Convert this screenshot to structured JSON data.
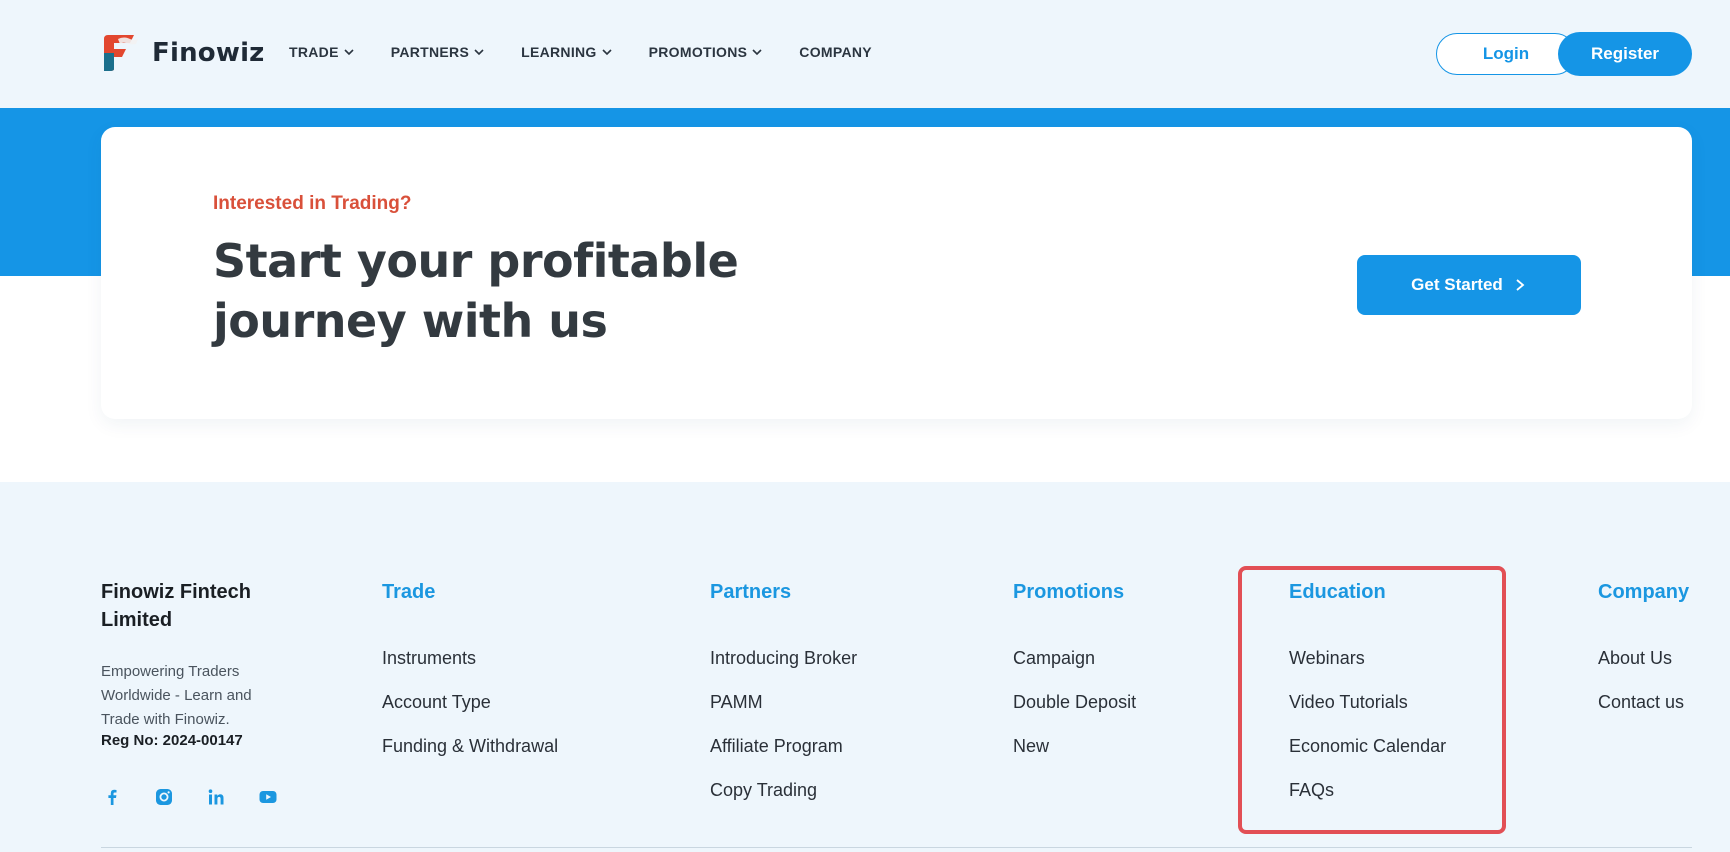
{
  "header": {
    "brand": "Finowiz",
    "nav": [
      {
        "label": "TRADE",
        "has_dropdown": true
      },
      {
        "label": "PARTNERS",
        "has_dropdown": true
      },
      {
        "label": "LEARNING",
        "has_dropdown": true
      },
      {
        "label": "PROMOTIONS",
        "has_dropdown": true
      },
      {
        "label": "COMPANY",
        "has_dropdown": false
      }
    ],
    "login_label": "Login",
    "register_label": "Register"
  },
  "cta": {
    "eyebrow": "Interested in Trading?",
    "title": "Start your profitable journey with us",
    "button_label": "Get Started",
    "button_icon": "chevron-right-icon"
  },
  "footer": {
    "company_name": "Finowiz Fintech Limited",
    "description": "Empowering Traders Worldwide - Learn and Trade with Finowiz.",
    "reg": "Reg No: 2024-00147",
    "socials": [
      "facebook-icon",
      "instagram-icon",
      "linkedin-icon",
      "youtube-icon"
    ],
    "columns": [
      {
        "heading": "Trade",
        "links": [
          "Instruments",
          "Account Type",
          "Funding & Withdrawal"
        ]
      },
      {
        "heading": "Partners",
        "links": [
          "Introducing Broker",
          "PAMM",
          "Affiliate Program",
          "Copy Trading"
        ]
      },
      {
        "heading": "Promotions",
        "links": [
          "Campaign",
          "Double Deposit",
          "New"
        ]
      },
      {
        "heading": "Education",
        "links": [
          "Webinars",
          "Video Tutorials",
          "Economic Calendar",
          "FAQs"
        ]
      },
      {
        "heading": "Company",
        "links": [
          "About Us",
          "Contact us"
        ]
      }
    ]
  },
  "colors": {
    "brand_blue": "#1595e6",
    "eyebrow_red": "#d9503a",
    "highlight_red": "#e24f55",
    "footer_bg": "#eef6fc"
  }
}
